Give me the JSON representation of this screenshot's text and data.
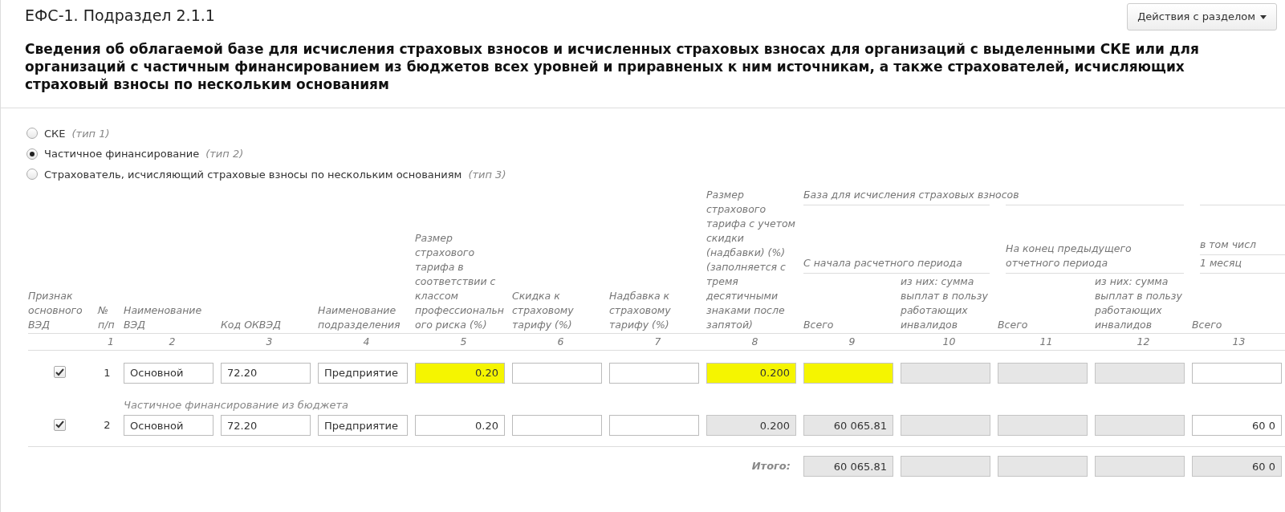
{
  "header": {
    "title": "ЕФС-1. Подраздел 2.1.1",
    "actions_button": "Действия с разделом"
  },
  "section_title": "Сведения об облагаемой базе для исчисления страховых взносов и исчисленных страховых взносах для организаций с выделенными СКЕ или для организаций с частичным финансированием из бюджетов всех уровней и приравненых к ним источникам, а также страхователей, исчисляющих страховый взносы по нескольким основаниям",
  "type_options": [
    {
      "label": "СКЕ",
      "note": "(тип 1)",
      "selected": false
    },
    {
      "label": "Частичное финансирование",
      "note": "(тип 2)",
      "selected": true
    },
    {
      "label": "Страхователь, исчисляющий страховые взносы по нескольким основаниям",
      "note": "(тип 3)",
      "selected": false
    }
  ],
  "table": {
    "columns": [
      "Признак основного ВЭД",
      "№ п/п",
      "Наименование ВЭД",
      "Код ОКВЭД",
      "Наименование подразделения",
      "Размер страхового тарифа в соответствии с классом профессионального риска (%)",
      "Скидка к страховому тарифу (%)",
      "Надбавка к страховому тарифу (%)",
      "Размер страхового тарифа с учетом скидки (надбавки) (%) (заполняется с тремя десятичными знаками после запятой)",
      "Всего",
      "из них: сумма выплат в пользу работающих инвалидов",
      "Всего",
      "из них: сумма выплат в пользу работающих инвалидов",
      "Всего"
    ],
    "group_header": "База для исчисления страховых взносов",
    "subgroups": [
      "С начала расчетного периода",
      "На конец предыдущего отчетного периода",
      "в том числ"
    ],
    "month_header": "1 месяц",
    "column_numbers": [
      "1",
      "2",
      "3",
      "4",
      "5",
      "6",
      "7",
      "8",
      "9",
      "10",
      "11",
      "12",
      "13"
    ],
    "rows": [
      {
        "kind": "row",
        "checked": true,
        "number": "1",
        "cells": [
          {
            "value": "Основной",
            "readonly": false,
            "highlighted": false
          },
          {
            "value": "72.20",
            "readonly": false,
            "highlighted": false
          },
          {
            "value": "Предприятие",
            "readonly": false,
            "highlighted": false
          },
          {
            "value": "0.20",
            "readonly": false,
            "highlighted": true
          },
          {
            "readonly": false,
            "highlighted": false
          },
          {
            "readonly": false,
            "highlighted": false
          },
          {
            "value": "0.200",
            "readonly": true,
            "highlighted": true
          },
          {
            "readonly": true,
            "highlighted": true
          },
          {
            "readonly": true,
            "highlighted": false
          },
          {
            "readonly": true,
            "highlighted": false
          },
          {
            "readonly": true,
            "highlighted": false
          },
          {
            "readonly": false,
            "highlighted": false
          }
        ]
      },
      {
        "kind": "label",
        "text": "Частичное финансирование из бюджета"
      },
      {
        "kind": "row",
        "checked": true,
        "number": "2",
        "cells": [
          {
            "value": "Основной",
            "readonly": false,
            "highlighted": false
          },
          {
            "value": "72.20",
            "readonly": false,
            "highlighted": false
          },
          {
            "value": "Предприятие",
            "readonly": false,
            "highlighted": false
          },
          {
            "value": "0.20",
            "readonly": false,
            "highlighted": false
          },
          {
            "readonly": false,
            "highlighted": false
          },
          {
            "readonly": false,
            "highlighted": false
          },
          {
            "value": "0.200",
            "readonly": true,
            "highlighted": false
          },
          {
            "value": "60 065.81",
            "readonly": true,
            "highlighted": false
          },
          {
            "readonly": true,
            "highlighted": false
          },
          {
            "readonly": true,
            "highlighted": false
          },
          {
            "readonly": true,
            "highlighted": false
          },
          {
            "value": "60 0",
            "readonly": false,
            "highlighted": false
          }
        ]
      }
    ],
    "total": {
      "label": "Итого:",
      "cells": [
        {
          "value": "60 065.81",
          "readonly": true
        },
        {
          "readonly": true
        },
        {
          "readonly": true
        },
        {
          "readonly": true
        },
        {
          "value": "60 0",
          "readonly": true
        }
      ]
    }
  }
}
